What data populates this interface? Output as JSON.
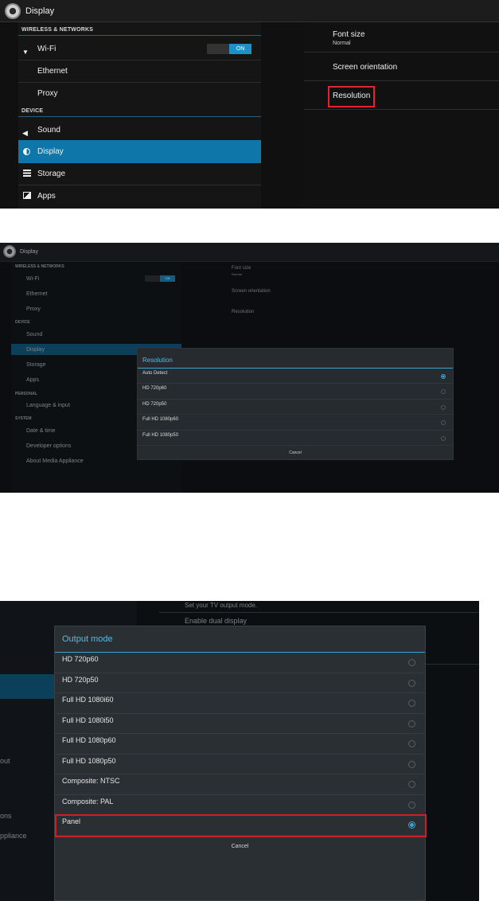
{
  "panel1": {
    "title": "Display",
    "categories": {
      "wireless": "WIRELESS & NETWORKS",
      "device": "DEVICE"
    },
    "wifi": {
      "label": "Wi-Fi",
      "toggle": "ON"
    },
    "ethernet": "Ethernet",
    "proxy": "Proxy",
    "sound": "Sound",
    "display": "Display",
    "storage": "Storage",
    "apps": "Apps",
    "font_size": {
      "label": "Font size",
      "value": "Normal"
    },
    "screen_orientation": "Screen orientation",
    "resolution": "Resolution"
  },
  "panel2": {
    "title": "Display",
    "categories": {
      "wireless": "WIRELESS & NETWORKS",
      "device": "DEVICE",
      "personal": "PERSONAL",
      "system": "SYSTEM"
    },
    "wifi": {
      "label": "Wi-Fi",
      "toggle": "ON"
    },
    "ethernet": "Ethernet",
    "proxy": "Proxy",
    "sound": "Sound",
    "display": "Display",
    "storage": "Storage",
    "apps": "Apps",
    "language": "Language & input",
    "datetime": "Date & time",
    "developer": "Developer options",
    "about": "About Media Appliance",
    "font_size": {
      "label": "Font size",
      "value": "Normal"
    },
    "screen_orientation": "Screen orientation",
    "resolution": "Resolution",
    "dialog": {
      "title": "Resolution",
      "options": [
        "Auto Detect",
        "HD 720p60",
        "HD 720p50",
        "Full HD 1080p60",
        "Full HD 1080p50"
      ],
      "selected_index": 0,
      "cancel": "Cancel"
    }
  },
  "panel3": {
    "left_fragments": [
      "out",
      "ons",
      "ppliance"
    ],
    "top_hint": "Set your TV output mode.",
    "dual_display": "Enable dual display",
    "dialog": {
      "title": "Output mode",
      "options": [
        "HD 720p60",
        "HD 720p50",
        "Full HD 1080i60",
        "Full HD 1080i50",
        "Full HD 1080p60",
        "Full HD 1080p50",
        "Composite: NTSC",
        "Composite: PAL",
        "Panel"
      ],
      "selected_index": 8,
      "cancel": "Cancel"
    }
  }
}
